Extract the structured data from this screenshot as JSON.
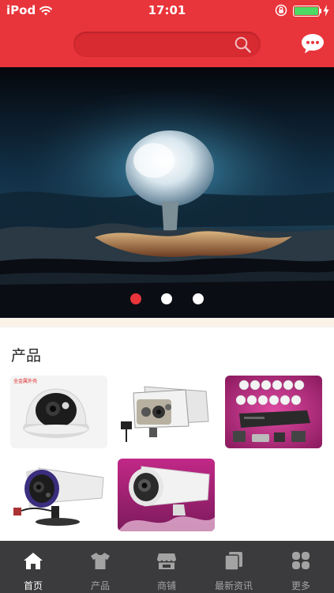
{
  "status_bar": {
    "carrier": "iPod",
    "time": "17:01"
  },
  "header": {
    "search_icon": "search-icon",
    "chat_icon": "chat-bubble-icon",
    "color": "#e8353b"
  },
  "banner": {
    "image": "mushroom-cloud-photo",
    "page_count": 3,
    "active_index": 0
  },
  "products": {
    "title": "产品",
    "items": [
      {
        "image": "dome-camera-photo",
        "caption": "全金属外壳"
      },
      {
        "image": "bullet-camera-box-photo"
      },
      {
        "image": "dvr-camera-kit-photo"
      },
      {
        "image": "bullet-camera-purple-ring-photo"
      },
      {
        "image": "bullet-camera-pink-bg-photo"
      }
    ]
  },
  "tabbar": {
    "tabs": [
      {
        "label": "首页",
        "icon": "home-icon",
        "active": true
      },
      {
        "label": "产品",
        "icon": "tshirt-icon",
        "active": false
      },
      {
        "label": "商铺",
        "icon": "store-icon",
        "active": false
      },
      {
        "label": "最新资讯",
        "icon": "news-icon",
        "active": false
      },
      {
        "label": "更多",
        "icon": "grid-icon",
        "active": false
      }
    ]
  }
}
